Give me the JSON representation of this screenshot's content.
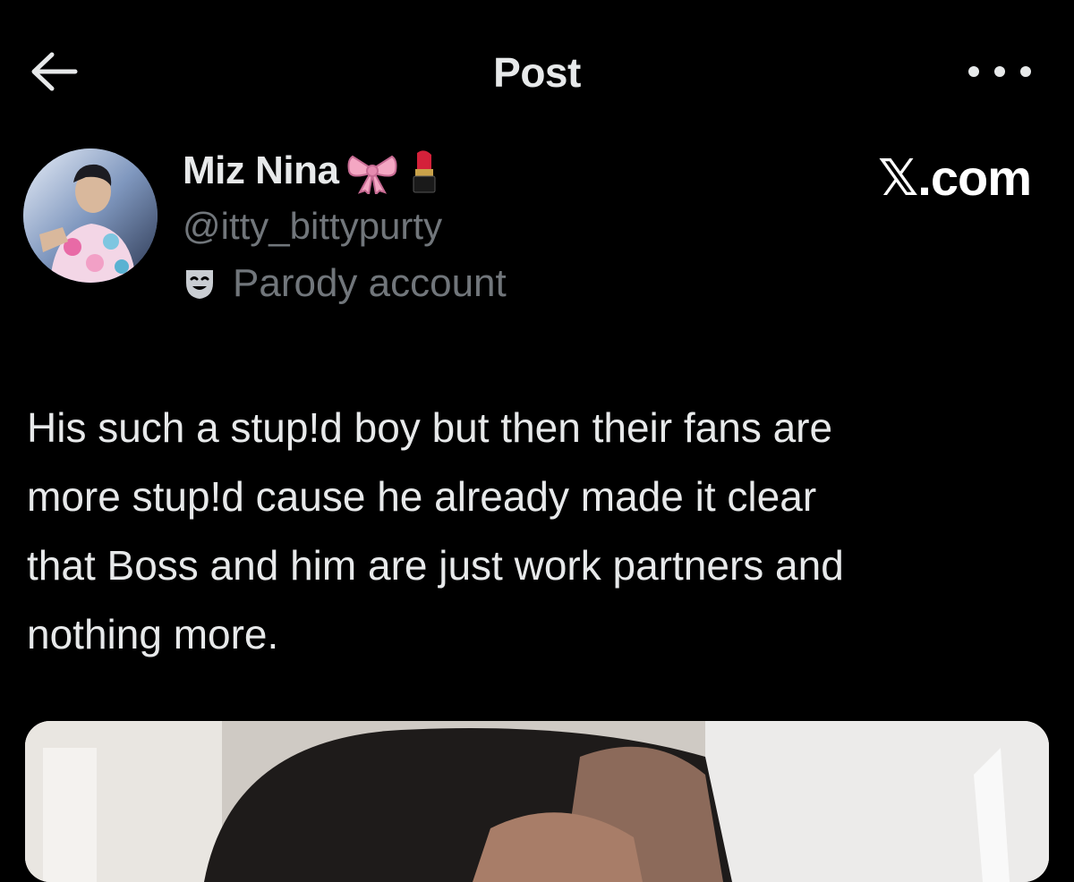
{
  "header": {
    "title": "Post",
    "back_icon": "arrow-left-icon",
    "more_icon": "more-horizontal-icon"
  },
  "author": {
    "display_name": "Miz Nina",
    "name_emojis": [
      "ribbon",
      "lipstick"
    ],
    "handle": "@itty_bittypurty",
    "label": "Parody account",
    "label_icon": "theater-mask-icon"
  },
  "source": "𝕏.com",
  "post": {
    "text": "His such a stup!d boy but then their fans are\nmore stup!d cause he already made it clear\nthat Boss and him are just work partners and\nnothing more."
  },
  "colors": {
    "background": "#000000",
    "primary_text": "#e7e9ea",
    "secondary_text": "#71767b"
  }
}
